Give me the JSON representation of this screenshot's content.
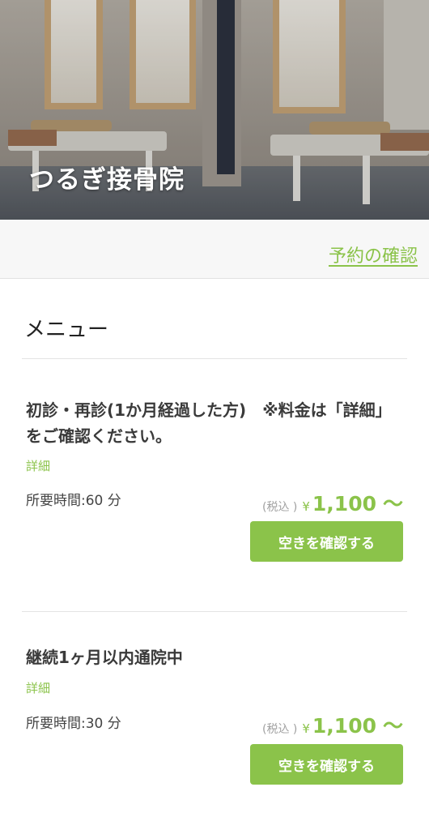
{
  "header": {
    "clinic_name": "つるぎ接骨院"
  },
  "subheader": {
    "reservation_link": "予約の確認"
  },
  "menu": {
    "heading": "メニュー",
    "items": [
      {
        "title": "初診・再診(1か月経過した方)　※料金は「詳細」をご確認ください。",
        "detail_label": "詳細",
        "duration": "所要時間:60 分",
        "tax_label": "(税込 )",
        "currency": "¥",
        "price": "1,100",
        "price_suffix": "〜",
        "button_label": "空きを確認する"
      },
      {
        "title": "継続1ヶ月以内通院中",
        "detail_label": "詳細",
        "duration": "所要時間:30 分",
        "tax_label": "(税込 )",
        "currency": "¥",
        "price": "1,100",
        "price_suffix": "〜",
        "button_label": "空きを確認する"
      }
    ]
  },
  "colors": {
    "accent": "#8bc34a",
    "text": "#333333",
    "muted": "#a0a0a0"
  }
}
